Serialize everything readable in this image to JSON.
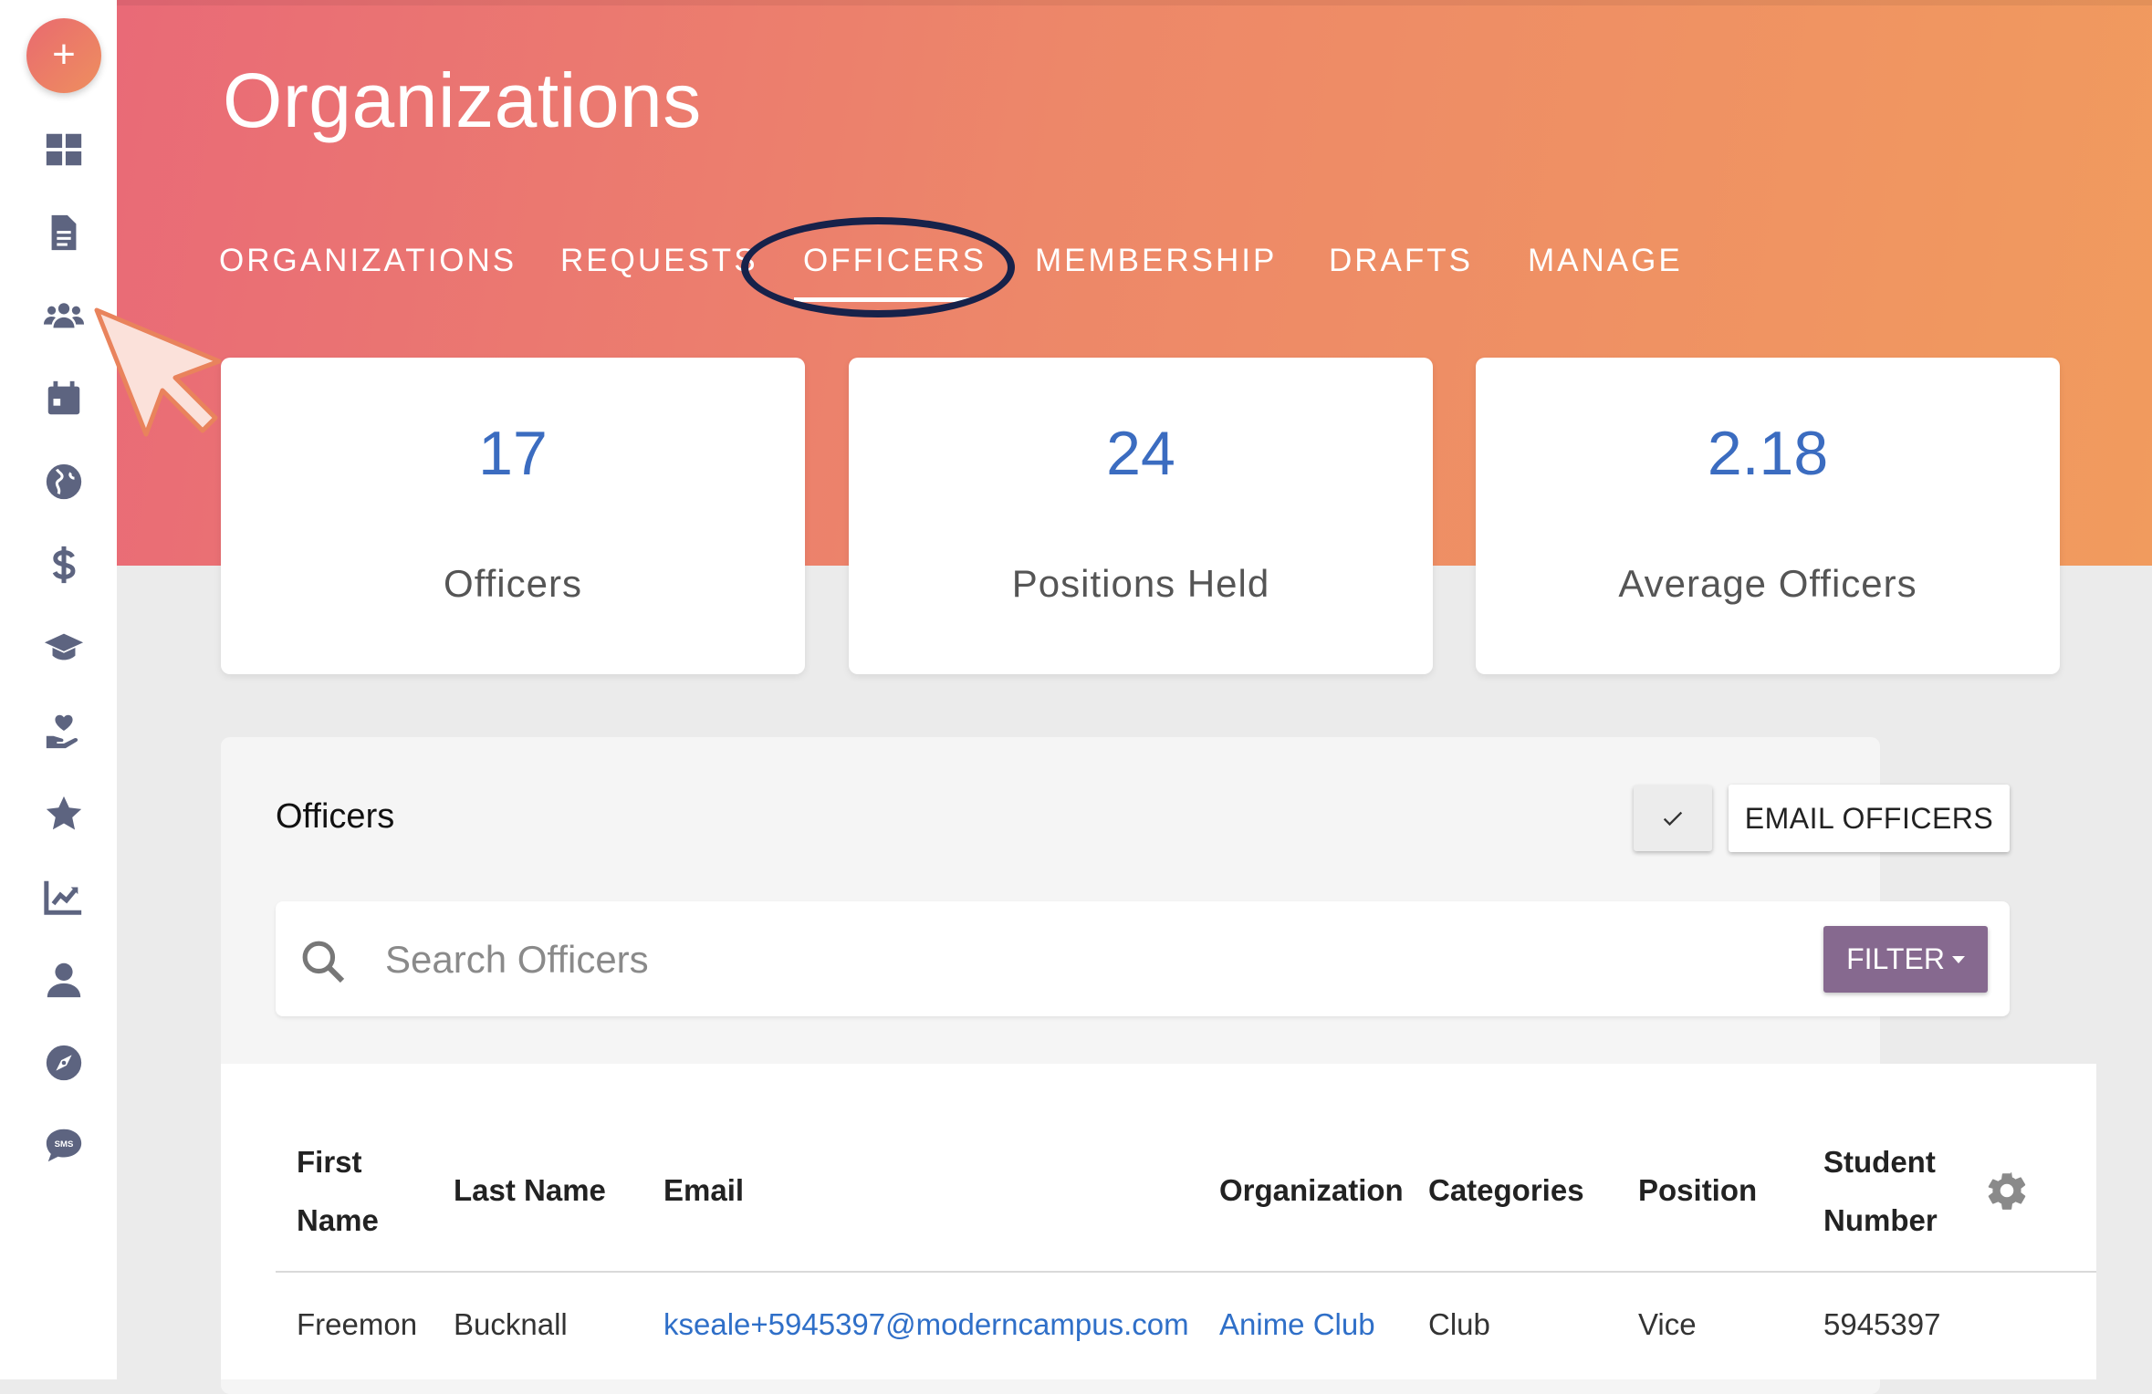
{
  "header": {
    "title": "Organizations",
    "tabs": [
      "ORGANIZATIONS",
      "REQUESTS",
      "OFFICERS",
      "MEMBERSHIP",
      "DRAFTS",
      "MANAGE"
    ],
    "active_tab": "OFFICERS"
  },
  "sidebar": {
    "add_label": "+",
    "icons": [
      "dashboard-icon",
      "document-icon",
      "users-icon",
      "calendar-icon",
      "globe-icon",
      "dollar-icon",
      "graduation-cap-icon",
      "hand-heart-icon",
      "star-icon",
      "chart-line-icon",
      "user-icon",
      "compass-icon",
      "sms-icon"
    ]
  },
  "stats": [
    {
      "value": "17",
      "label": "Officers"
    },
    {
      "value": "24",
      "label": "Positions Held"
    },
    {
      "value": "2.18",
      "label": "Average Officers"
    }
  ],
  "panel": {
    "title": "Officers",
    "email_button": "EMAIL OFFICERS",
    "search_placeholder": "Search Officers",
    "filter_button": "FILTER"
  },
  "table": {
    "columns": {
      "first_name": [
        "First",
        "Name"
      ],
      "last_name": "Last Name",
      "email": "Email",
      "organization": "Organization",
      "categories": "Categories",
      "position": "Position",
      "student_number": [
        "Student",
        "Number"
      ]
    },
    "rows": [
      {
        "first_name": "Freemon",
        "last_name": "Bucknall",
        "email": "kseale+5945397@moderncampus.com",
        "organization": "Anime Club",
        "categories": "Club",
        "position": "Vice",
        "student_number": "5945397"
      }
    ]
  },
  "colors": {
    "header_gradient_start": "#e96a77",
    "header_gradient_end": "#f19b5e",
    "stat_value": "#3b6cc0",
    "link": "#2f6fc8",
    "filter_button": "#86698f",
    "annotation_circle": "#17224a"
  }
}
